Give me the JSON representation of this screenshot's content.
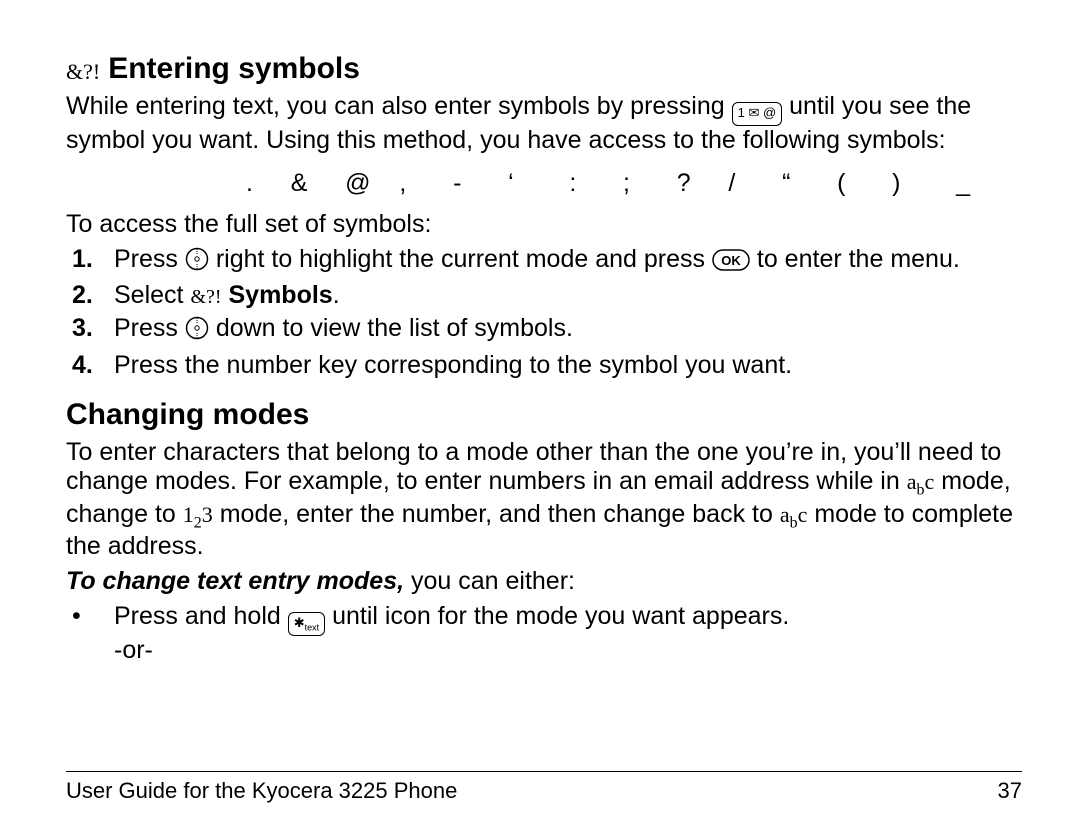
{
  "section1": {
    "icon_label": "&?!",
    "title": "Entering symbols",
    "intro_a": "While entering text, you can also enter symbols by pressing ",
    "intro_b": " until you see the symbol you want. Using this method, you have access to the following symbols:",
    "symbols_row": ".    &    @   ,     -     ‘      :     ;     ?    /     “     (     )      _",
    "access_label": "To access the full set of symbols:",
    "steps": [
      {
        "n": "1.",
        "a": "Press ",
        "b": " right to highlight the current mode and press ",
        "c": " to enter the menu."
      },
      {
        "n": "2.",
        "a": "Select  ",
        "icon_label": "&?!",
        "b_bold": " Symbols",
        "c": "."
      },
      {
        "n": "3.",
        "a": "Press ",
        "b": " down to view the list of symbols."
      },
      {
        "n": "4.",
        "a": "Press the number key corresponding to the symbol you want."
      }
    ]
  },
  "section2": {
    "title": "Changing modes",
    "p1_a": "To enter characters that belong to a mode other than the one you’re in, you’ll need to change modes. For example, to enter numbers in an email address while in ",
    "p1_b": " mode, change to ",
    "p1_c": " mode, enter the number, and then change back to ",
    "p1_d": " mode to complete the address.",
    "p2_bold": "To change text entry modes,",
    "p2_rest": " you can either:",
    "bullet_a": "Press and hold ",
    "bullet_b": " until icon for the mode you want appears.",
    "or": "-or-",
    "icons": {
      "abc": "abc",
      "n123": "123",
      "star_text": "✱ text",
      "envkey": "1 ✉ @",
      "ok": "OK"
    }
  },
  "footer": {
    "left": "User Guide for the Kyocera 3225 Phone",
    "right": "37"
  }
}
